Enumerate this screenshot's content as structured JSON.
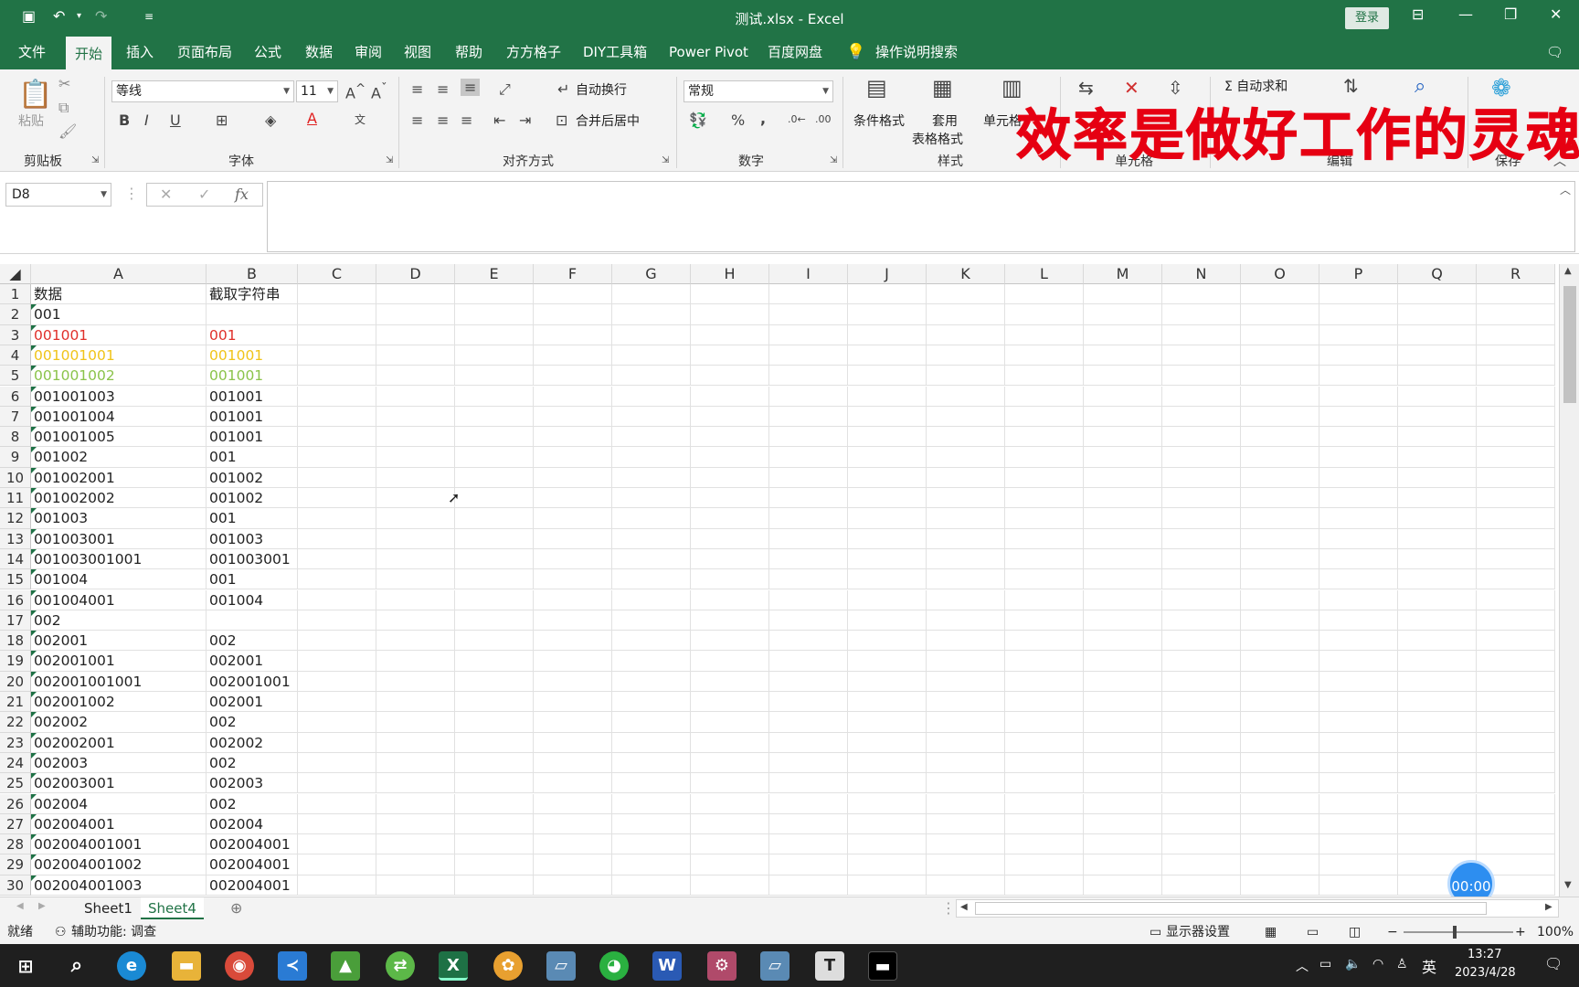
{
  "titlebar": {
    "title": "测试.xlsx  -  Excel",
    "login": "登录"
  },
  "menu": [
    "文件",
    "开始",
    "插入",
    "页面布局",
    "公式",
    "数据",
    "审阅",
    "视图",
    "帮助",
    "方方格子",
    "DIY工具箱",
    "Power Pivot",
    "百度网盘",
    "操作说明搜索"
  ],
  "ribbon": {
    "paste": "粘贴",
    "font_name": "等线",
    "font_size": "11",
    "wrap_text": "自动换行",
    "merge_center": "合并后居中",
    "number_format": "常规",
    "cond_format": "条件格式",
    "table_format_1": "套用",
    "table_format_2": "表格格式",
    "cell_style": "单元格",
    "autosum": "Σ 自动求和",
    "groups": {
      "clipboard": "剪贴板",
      "font": "字体",
      "alignment": "对齐方式",
      "number": "数字",
      "styles": "样式",
      "cells": "单元格",
      "editing": "编辑",
      "save": "保存"
    }
  },
  "overlay_text": "效率是做好工作的灵魂",
  "name_box": "D8",
  "fx_label": "fx",
  "columns": [
    "A",
    "B",
    "C",
    "D",
    "E",
    "F",
    "G",
    "H",
    "I",
    "J",
    "K",
    "L",
    "M",
    "N",
    "O",
    "P",
    "Q",
    "R"
  ],
  "rows": [
    {
      "n": "1",
      "a": "数据",
      "b": "截取字符串",
      "color": "#222",
      "tri": false
    },
    {
      "n": "2",
      "a": "001",
      "b": "",
      "color": "#222",
      "tri": true
    },
    {
      "n": "3",
      "a": "001001",
      "b": "001",
      "color": "#e0302a",
      "tri": true
    },
    {
      "n": "4",
      "a": "001001001",
      "b": "001001",
      "color": "#f0c419",
      "tri": true
    },
    {
      "n": "5",
      "a": "001001002",
      "b": "001001",
      "color": "#8bc34a",
      "tri": true
    },
    {
      "n": "6",
      "a": "001001003",
      "b": "001001",
      "color": "#222",
      "tri": true
    },
    {
      "n": "7",
      "a": "001001004",
      "b": "001001",
      "color": "#222",
      "tri": true
    },
    {
      "n": "8",
      "a": "001001005",
      "b": "001001",
      "color": "#222",
      "tri": true
    },
    {
      "n": "9",
      "a": "001002",
      "b": "001",
      "color": "#222",
      "tri": true
    },
    {
      "n": "10",
      "a": "001002001",
      "b": "001002",
      "color": "#222",
      "tri": true
    },
    {
      "n": "11",
      "a": "001002002",
      "b": "001002",
      "color": "#222",
      "tri": true
    },
    {
      "n": "12",
      "a": "001003",
      "b": "001",
      "color": "#222",
      "tri": true
    },
    {
      "n": "13",
      "a": "001003001",
      "b": "001003",
      "color": "#222",
      "tri": true
    },
    {
      "n": "14",
      "a": "001003001001",
      "b": "001003001",
      "color": "#222",
      "tri": true
    },
    {
      "n": "15",
      "a": "001004",
      "b": "001",
      "color": "#222",
      "tri": true
    },
    {
      "n": "16",
      "a": "001004001",
      "b": "001004",
      "color": "#222",
      "tri": true
    },
    {
      "n": "17",
      "a": "002",
      "b": "",
      "color": "#222",
      "tri": true
    },
    {
      "n": "18",
      "a": "002001",
      "b": "002",
      "color": "#222",
      "tri": true
    },
    {
      "n": "19",
      "a": "002001001",
      "b": "002001",
      "color": "#222",
      "tri": true
    },
    {
      "n": "20",
      "a": "002001001001",
      "b": "002001001",
      "color": "#222",
      "tri": true
    },
    {
      "n": "21",
      "a": "002001002",
      "b": "002001",
      "color": "#222",
      "tri": true
    },
    {
      "n": "22",
      "a": "002002",
      "b": "002",
      "color": "#222",
      "tri": true
    },
    {
      "n": "23",
      "a": "002002001",
      "b": "002002",
      "color": "#222",
      "tri": true
    },
    {
      "n": "24",
      "a": "002003",
      "b": "002",
      "color": "#222",
      "tri": true
    },
    {
      "n": "25",
      "a": "002003001",
      "b": "002003",
      "color": "#222",
      "tri": true
    },
    {
      "n": "26",
      "a": "002004",
      "b": "002",
      "color": "#222",
      "tri": true
    },
    {
      "n": "27",
      "a": "002004001",
      "b": "002004",
      "color": "#222",
      "tri": true
    },
    {
      "n": "28",
      "a": "002004001001",
      "b": "002004001",
      "color": "#222",
      "tri": true
    },
    {
      "n": "29",
      "a": "002004001002",
      "b": "002004001",
      "color": "#222",
      "tri": true
    },
    {
      "n": "30",
      "a": "002004001003",
      "b": "002004001",
      "color": "#222",
      "tri": true
    }
  ],
  "sheet_tabs": [
    "Sheet1",
    "Sheet4"
  ],
  "status": {
    "ready": "就绪",
    "accessibility": "辅助功能: 调查",
    "display_settings": "显示器设置",
    "zoom": "100%"
  },
  "timer": "00:00",
  "taskbar": {
    "ime": "英",
    "time": "13:27",
    "date": "2023/4/28"
  }
}
